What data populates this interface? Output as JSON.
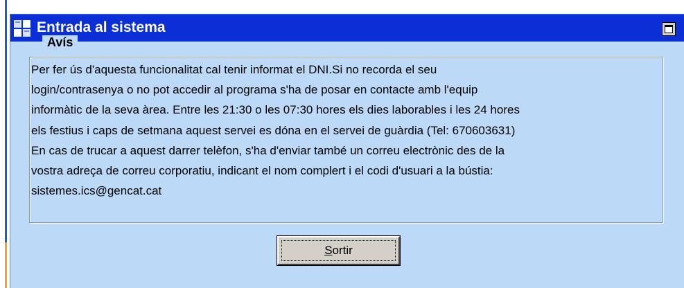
{
  "window": {
    "title": "Entrada al sistema"
  },
  "notice": {
    "legend": "Avís",
    "lines": [
      "Per fer ús d'aquesta funcionalitat cal tenir informat el DNI.Si no recorda el seu",
      "login/contrasenya o no pot accedir al programa s'ha de posar en contacte amb l'equip",
      "informàtic de la seva àrea. Entre les 21:30 o les 07:30 hores els dies laborables i les 24 hores",
      "els festius i caps de setmana aquest servei es dóna en el servei de guàrdia (Tel: 670603631)",
      "En cas de trucar a aquest darrer telèfon, s'ha d'enviar també un correu electrònic des de la",
      "vostra adreça de correu corporatiu, indicant el nom complert i el codi d'usuari a la bústia:",
      "sistemes.ics@gencat.cat"
    ]
  },
  "actions": {
    "sortir_mnemonic": "S",
    "sortir_rest": "ortir"
  },
  "colors": {
    "titlebar": "#0a2fd6",
    "panel": "#bcd9f7",
    "button_face": "#d4d0c8"
  }
}
